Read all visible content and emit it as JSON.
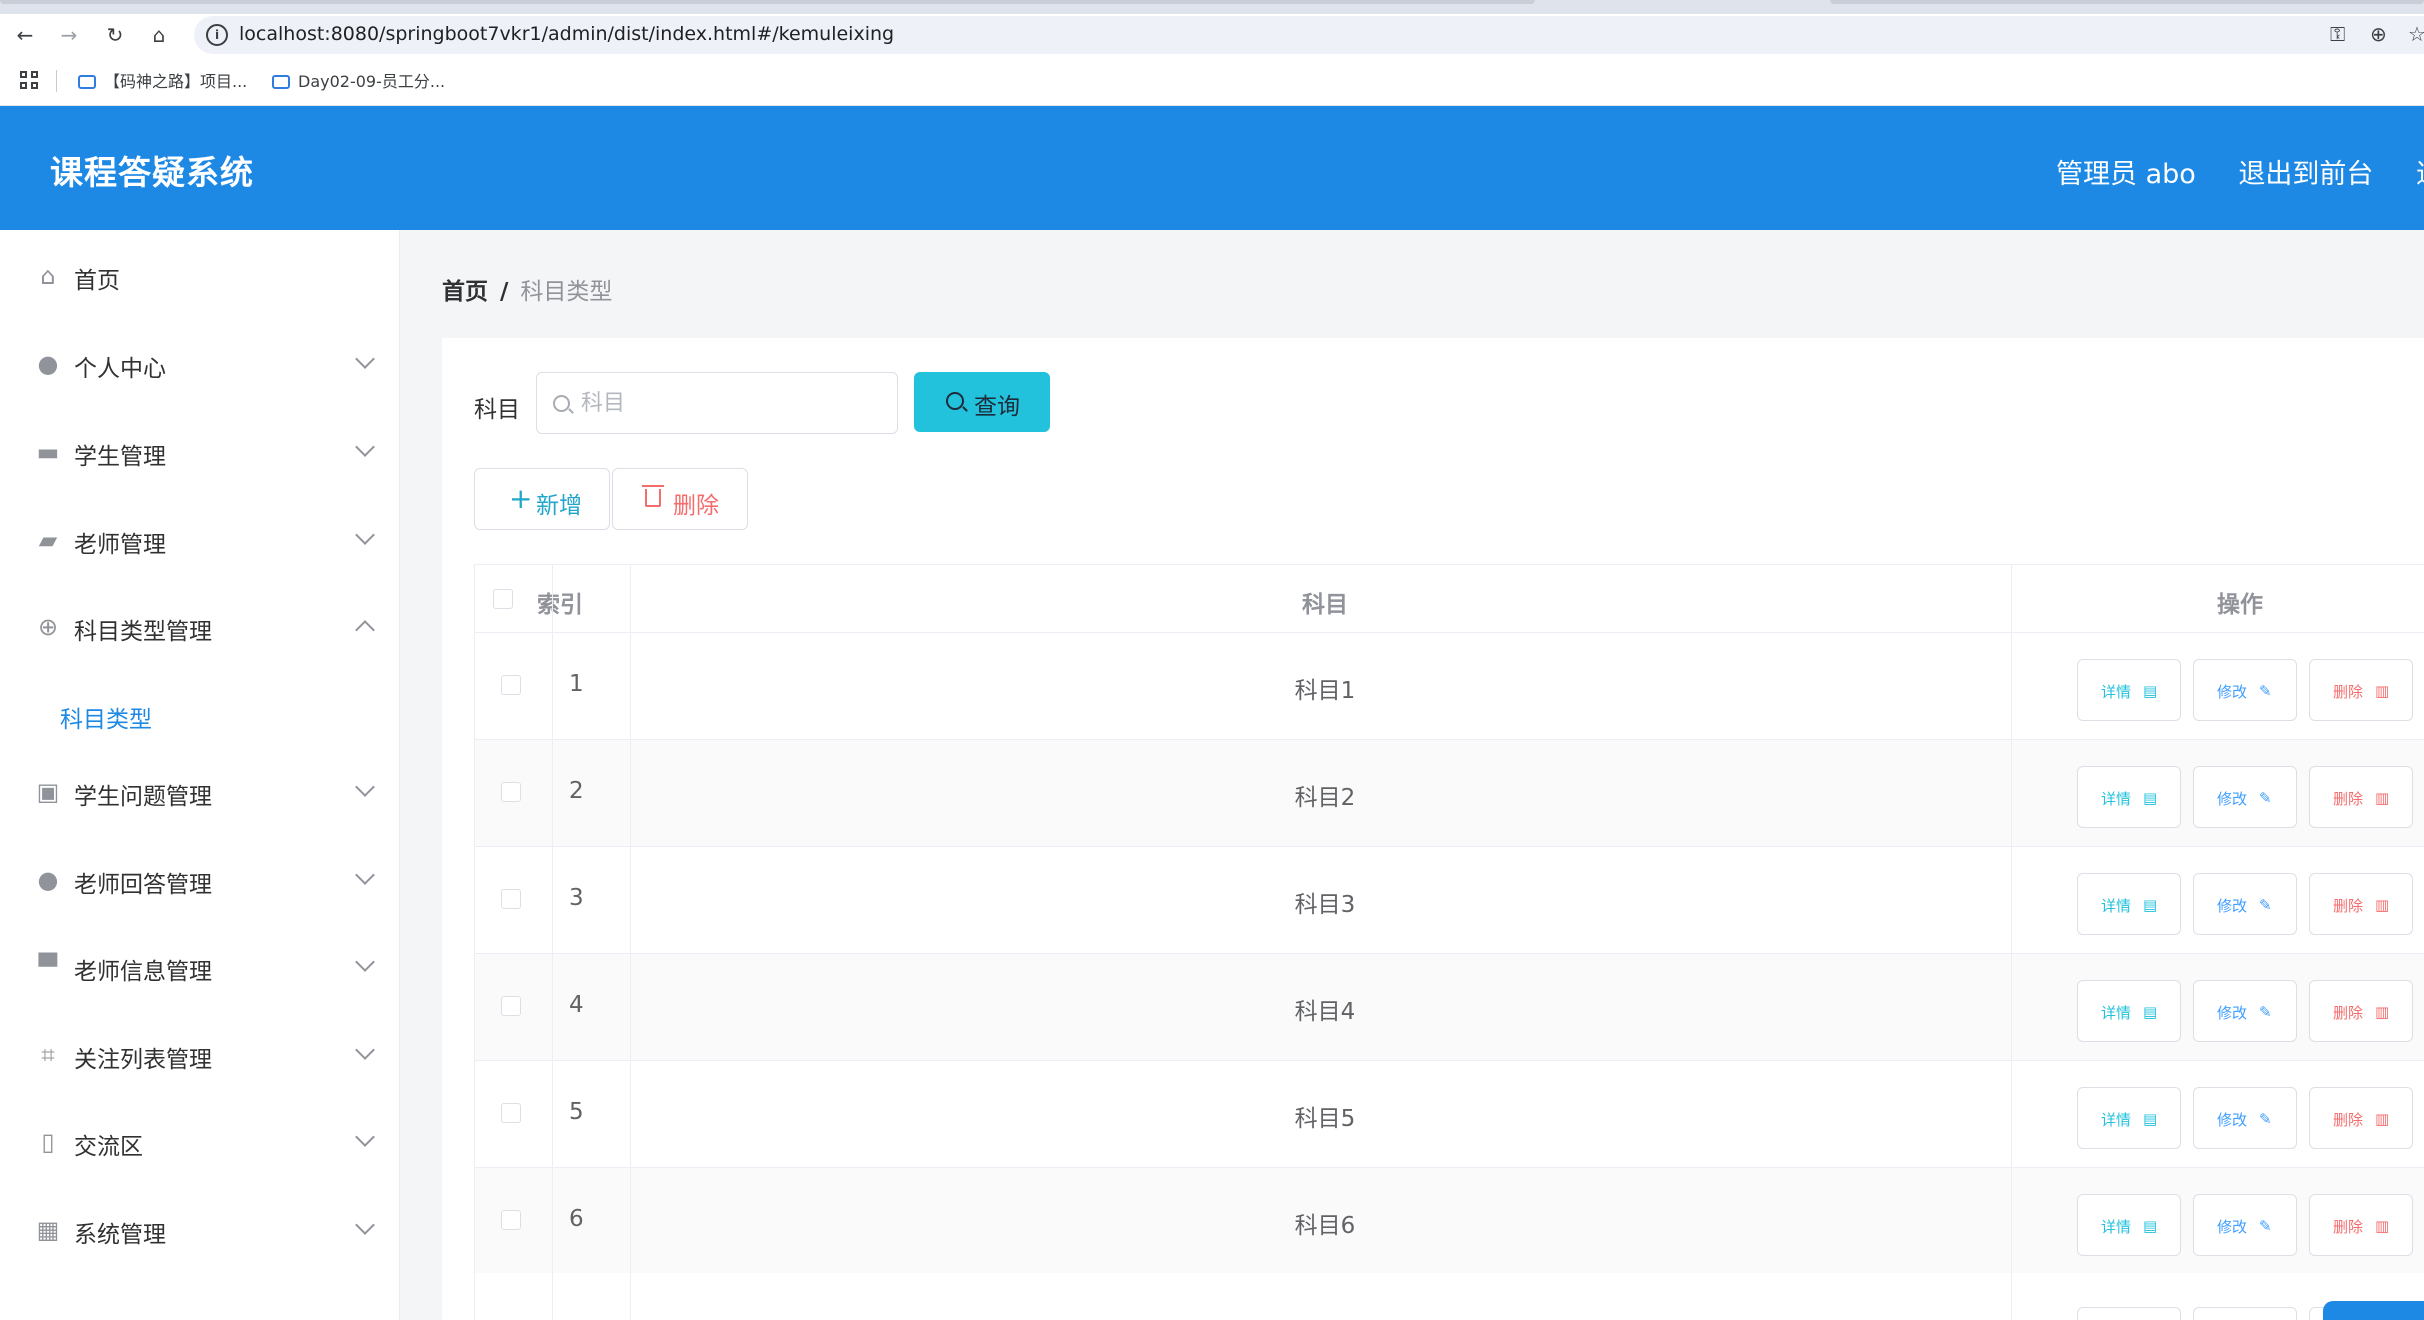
{
  "browser": {
    "url": "localhost:8080/springboot7vkr1/admin/dist/index.html#/kemuleixing",
    "bookmarks": [
      "【码神之路】项目...",
      "Day02-09-员工分..."
    ]
  },
  "header": {
    "title": "课程答疑系统",
    "user_label": "管理员 abo",
    "to_front_label": "退出到前台",
    "logout_label": "退出"
  },
  "sidebar": {
    "items": [
      {
        "label": "首页",
        "icon": "home-icon"
      },
      {
        "label": "个人中心",
        "icon": "user-icon"
      },
      {
        "label": "学生管理",
        "icon": "briefcase-icon"
      },
      {
        "label": "老师管理",
        "icon": "ticket-icon"
      },
      {
        "label": "科目类型管理",
        "icon": "aim-icon"
      },
      {
        "label": "学生问题管理",
        "icon": "clipboard-icon"
      },
      {
        "label": "老师回答管理",
        "icon": "user-icon"
      },
      {
        "label": "老师信息管理",
        "icon": "monitor-icon"
      },
      {
        "label": "关注列表管理",
        "icon": "crop-icon"
      },
      {
        "label": "交流区",
        "icon": "mic-icon"
      },
      {
        "label": "系统管理",
        "icon": "grid-icon"
      }
    ],
    "active_sub_label": "科目类型"
  },
  "breadcrumb": {
    "home": "首页",
    "separator": "/",
    "current": "科目类型"
  },
  "search": {
    "label": "科目",
    "placeholder": "科目",
    "button_label": "查询"
  },
  "actions": {
    "add_label": "新增",
    "delete_label": "删除"
  },
  "table": {
    "columns": {
      "index": "索引",
      "subject": "科目",
      "operations": "操作"
    },
    "rows": [
      {
        "index": "1",
        "subject": "科目1"
      },
      {
        "index": "2",
        "subject": "科目2"
      },
      {
        "index": "3",
        "subject": "科目3"
      },
      {
        "index": "4",
        "subject": "科目4"
      },
      {
        "index": "5",
        "subject": "科目5"
      },
      {
        "index": "6",
        "subject": "科目6"
      }
    ],
    "row_actions": {
      "detail": "详情",
      "edit": "修改",
      "delete": "删除"
    }
  },
  "colors": {
    "primary": "#1e88e5",
    "query_button": "#22c1dc",
    "danger": "#f56c6c",
    "edit": "#409eff"
  }
}
